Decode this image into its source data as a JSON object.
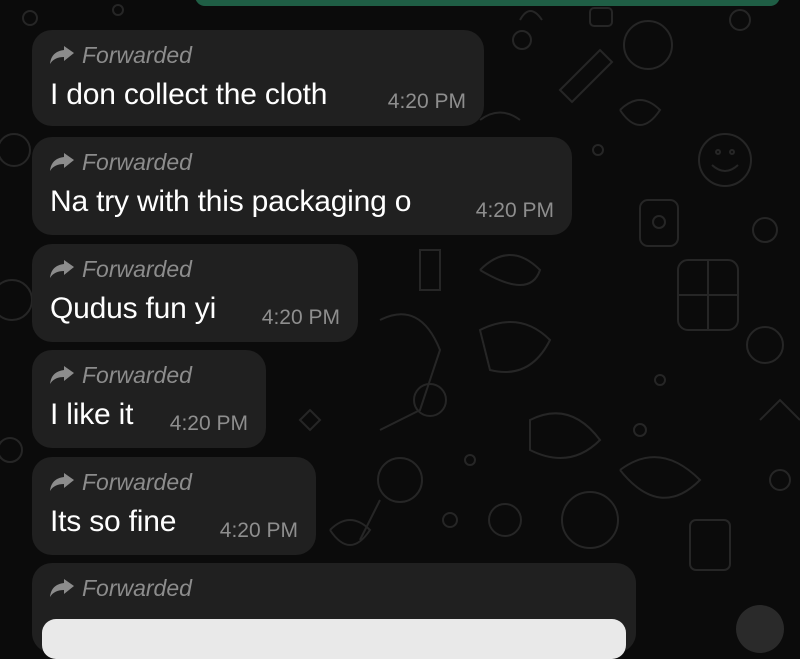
{
  "chat": {
    "messages": [
      {
        "forwarded_label": "Forwarded",
        "text": "I don collect the cloth",
        "time": "4:20 PM"
      },
      {
        "forwarded_label": "Forwarded",
        "text": "Na try with this packaging o",
        "time": "4:20 PM"
      },
      {
        "forwarded_label": "Forwarded",
        "text": "Qudus fun yi",
        "time": "4:20 PM"
      },
      {
        "forwarded_label": "Forwarded",
        "text": "I like it",
        "time": "4:20 PM"
      },
      {
        "forwarded_label": "Forwarded",
        "text": "Its so fine",
        "time": "4:20 PM"
      },
      {
        "forwarded_label": "Forwarded"
      }
    ]
  },
  "colors": {
    "background": "#0b0b0b",
    "bubble": "#202020",
    "outgoing_bubble_edge": "#1f5e45",
    "text": "#ffffff",
    "meta_text": "#8c8c8c"
  },
  "icons": {
    "forward": "forward-arrow-icon"
  }
}
